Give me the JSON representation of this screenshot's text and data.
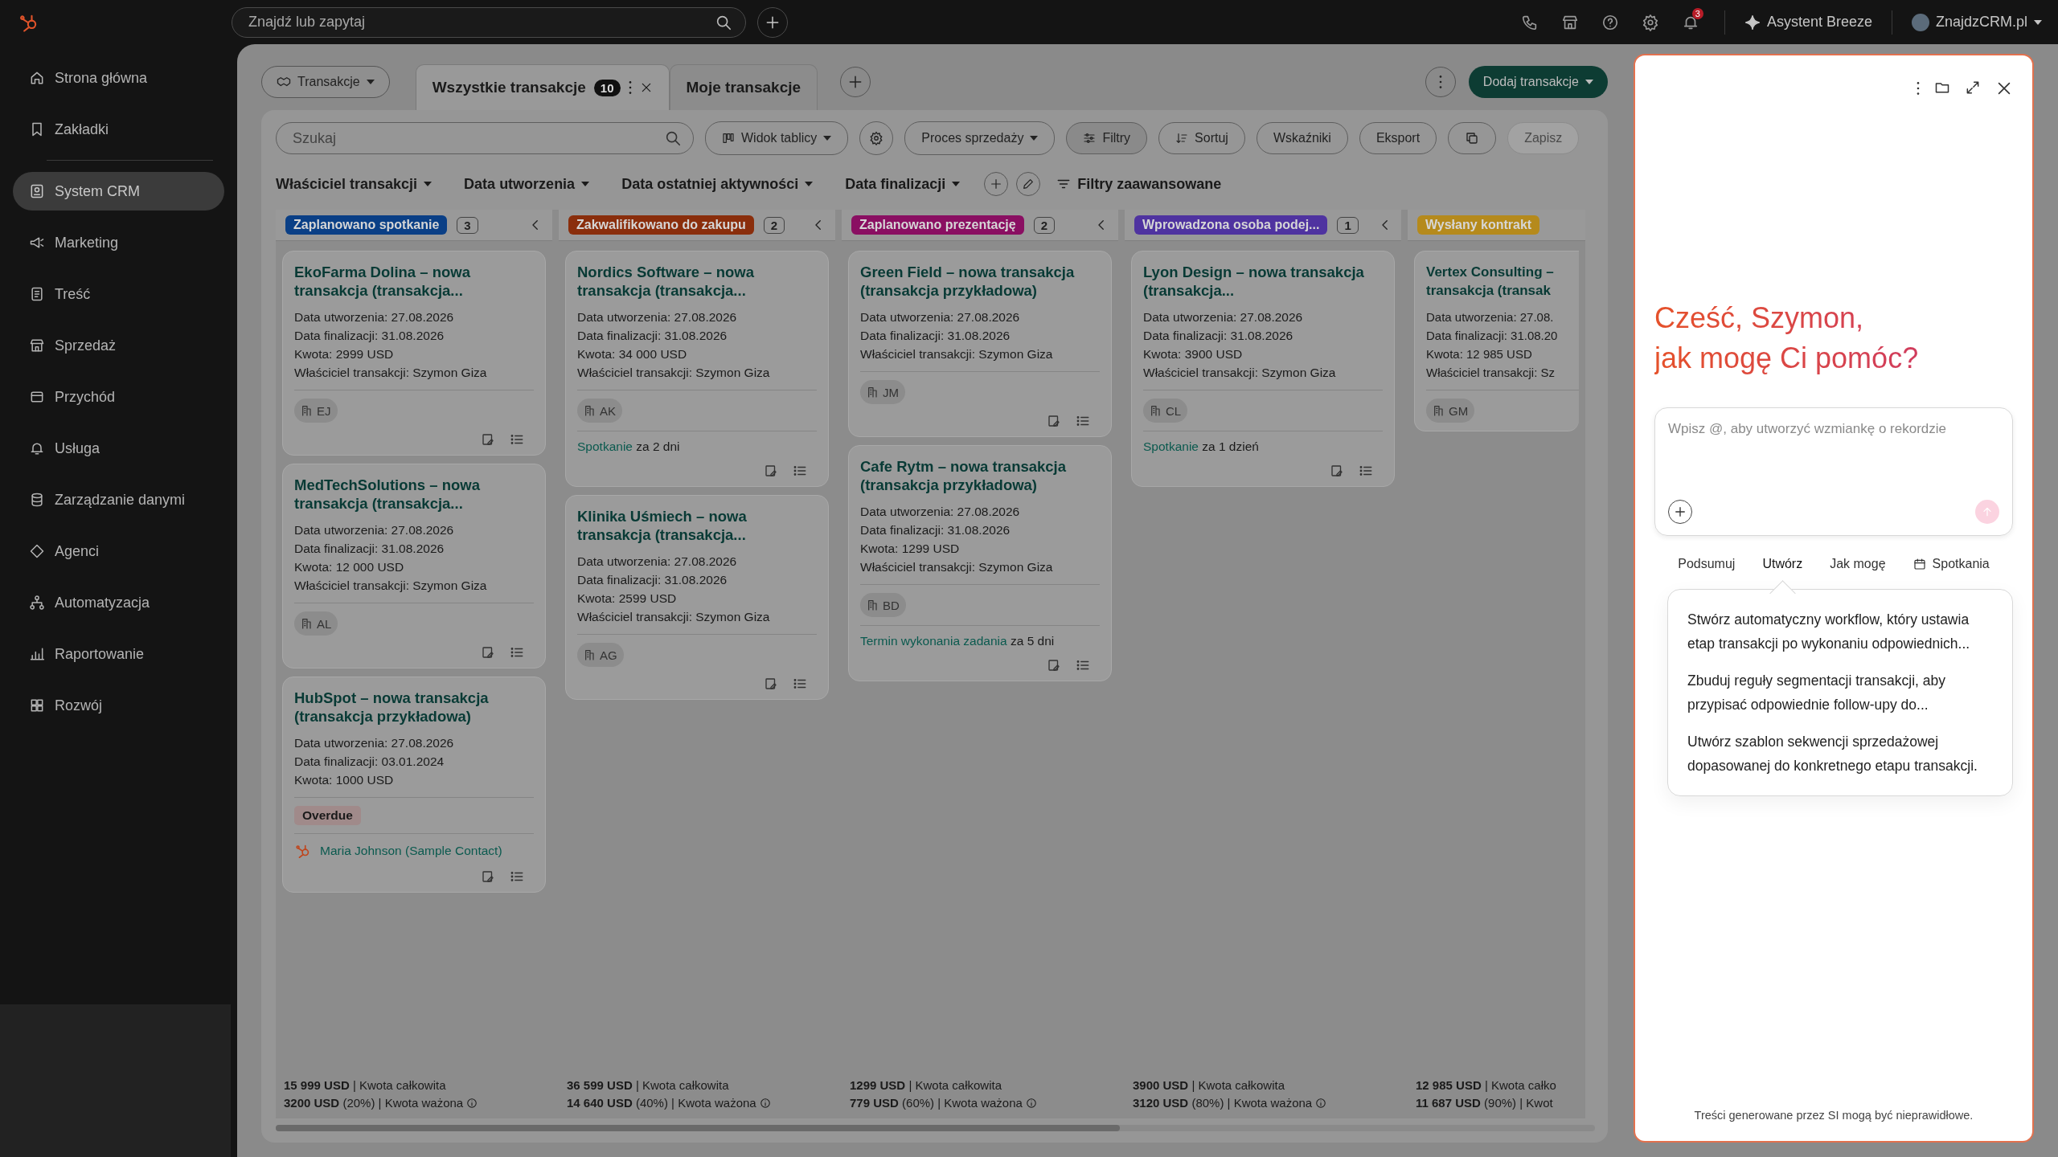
{
  "top_bar": {
    "search_placeholder": "Znajdź lub zapytaj",
    "notification_count": "3",
    "assistant": "Asystent Breeze",
    "account": "ZnajdzCRM.pl"
  },
  "sidebar": {
    "items": [
      {
        "label": "Strona główna",
        "selected": false
      },
      {
        "label": "Zakładki",
        "selected": false
      },
      {
        "label": "System CRM",
        "selected": true
      },
      {
        "label": "Marketing",
        "selected": false
      },
      {
        "label": "Treść",
        "selected": false
      },
      {
        "label": "Sprzedaż",
        "selected": false
      },
      {
        "label": "Przychód",
        "selected": false
      },
      {
        "label": "Usługa",
        "selected": false
      },
      {
        "label": "Zarządzanie danymi",
        "selected": false
      },
      {
        "label": "Agenci",
        "selected": false
      },
      {
        "label": "Automatyzacja",
        "selected": false
      },
      {
        "label": "Raportowanie",
        "selected": false
      },
      {
        "label": "Rozwój",
        "selected": false
      }
    ]
  },
  "object_selector": "Transakcje",
  "view_tabs": [
    {
      "label": "Wszystkie transakcje",
      "count": "10",
      "selected": true
    },
    {
      "label": "Moje transakcje",
      "selected": false
    }
  ],
  "add_button": "Dodaj transakcje",
  "toolbar": {
    "search_placeholder": "Szukaj",
    "view": "Widok tablicy",
    "pipeline": "Proces sprzedaży",
    "buttons": [
      {
        "label": "Filtry",
        "kind": "filter",
        "disabled": false
      },
      {
        "label": "Sortuj",
        "kind": "sort",
        "disabled": false
      },
      {
        "label": "Wskaźniki",
        "kind": "plain",
        "disabled": false
      },
      {
        "label": "Eksport",
        "kind": "plain",
        "disabled": false
      },
      {
        "kind": "copy",
        "disabled": false
      },
      {
        "label": "Zapisz",
        "kind": "plain",
        "disabled": true
      }
    ]
  },
  "filters": [
    "Właściciel transakcji",
    "Data utworzenia",
    "Data ostatniej aktywności",
    "Data finalizacji"
  ],
  "advanced_filters": "Filtry zaawansowane",
  "columns": [
    {
      "stage": "Zaplanowano spotkanie",
      "color": "#0a3f86",
      "count": "3",
      "cards": [
        {
          "title": "EkoFarma Dolina – nowa transakcja (transakcja...",
          "lines": [
            "Data utworzenia: 27.08.2026",
            "Data finalizacji: 31.08.2026",
            "Kwota: 2999 USD",
            "Właściciel transakcji: Szymon Giza"
          ],
          "initials": "EJ"
        },
        {
          "title": "MedTechSolutions – nowa transakcja (transakcja...",
          "lines": [
            "Data utworzenia: 27.08.2026",
            "Data finalizacji: 31.08.2026",
            "Kwota: 12 000 USD",
            "Właściciel transakcji: Szymon Giza"
          ],
          "initials": "AL"
        },
        {
          "title": "HubSpot – nowa transakcja (transakcja przykładowa)",
          "lines": [
            "Data utworzenia: 27.08.2026",
            "Data finalizacji: 03.01.2024",
            "Kwota: 1000 USD"
          ],
          "overdue": "Overdue",
          "contact": "Maria Johnson (Sample Contact)"
        }
      ],
      "total": "**15 999 USD** | Kwota całkowita",
      "weighted": "**3200 USD** (20%) | Kwota ważona"
    },
    {
      "stage": "Zakwalifikowano do zakupu",
      "color": "#8a2e0c",
      "count": "2",
      "cards": [
        {
          "title": "Nordics Software – nowa transakcja (transakcja...",
          "lines": [
            "Data utworzenia: 27.08.2026",
            "Data finalizacji: 31.08.2026",
            "Kwota: 34 000 USD",
            "Właściciel transakcji: Szymon Giza"
          ],
          "initials": "AK",
          "activity_link": "Spotkanie",
          "activity_text": "za 2 dni"
        },
        {
          "title": "Klinika Uśmiech – nowa transakcja (transakcja...",
          "lines": [
            "Data utworzenia: 27.08.2026",
            "Data finalizacji: 31.08.2026",
            "Kwota: 2599 USD",
            "Właściciel transakcji: Szymon Giza"
          ],
          "initials": "AG"
        }
      ],
      "total": "**36 599 USD** | Kwota całkowita",
      "weighted": "**14 640 USD** (40%) | Kwota ważona"
    },
    {
      "stage": "Zaplanowano prezentację",
      "color": "#8a0f62",
      "count": "2",
      "cards": [
        {
          "title": "Green Field – nowa transakcja (transakcja przykładowa)",
          "lines": [
            "Data utworzenia: 27.08.2026",
            "Data finalizacji: 31.08.2026",
            "Właściciel transakcji: Szymon Giza"
          ],
          "initials": "JM"
        },
        {
          "title": "Cafe Rytm – nowa transakcja (transakcja przykładowa)",
          "lines": [
            "Data utworzenia: 27.08.2026",
            "Data finalizacji: 31.08.2026",
            "Kwota: 1299 USD",
            "Właściciel transakcji: Szymon Giza"
          ],
          "initials": "BD",
          "activity_link": "Termin wykonania zadania",
          "activity_text": "za 5 dni"
        }
      ],
      "total": "**1299 USD** | Kwota całkowita",
      "weighted": "**779 USD** (60%) | Kwota ważona"
    },
    {
      "stage": "Wprowadzona osoba podej...",
      "color": "#4f33a0",
      "count": "1",
      "cards": [
        {
          "title": "Lyon Design – nowa transakcja (transakcja...",
          "lines": [
            "Data utworzenia: 27.08.2026",
            "Data finalizacji: 31.08.2026",
            "Kwota: 3900 USD",
            "Właściciel transakcji: Szymon Giza"
          ],
          "initials": "CL",
          "activity_link": "Spotkanie",
          "activity_text": "za 1 dzień"
        }
      ],
      "total": "**3900 USD** | Kwota całkowita",
      "weighted": "**3120 USD** (80%) | Kwota ważona"
    },
    {
      "stage": "Wysłany kontrakt",
      "color": "#b58a1c",
      "cards": [
        {
          "title": "Vertex Consulting – transakcja (transak",
          "lines": [
            "Data utworzenia: 27.08.",
            "Data finalizacji: 31.08.20",
            "Kwota: 12 985 USD",
            "Właściciel transakcji: Sz"
          ],
          "initials": "GM"
        }
      ],
      "total": "**12 985 USD** | Kwota całko",
      "weighted": "**11 687 USD** (90%) | Kwot"
    }
  ],
  "chat": {
    "greeting": [
      "Cześć, Szymon,",
      "jak mogę Ci pomóc?"
    ],
    "placeholder": "Wpisz @, aby utworzyć wzmiankę o rekordzie",
    "quick_actions": [
      {
        "label": "Podsumuj",
        "selected": false
      },
      {
        "label": "Utwórz",
        "selected": true
      },
      {
        "label": "Jak mogę",
        "selected": false
      },
      {
        "label": "Spotkania",
        "selected": false,
        "kind": "calendar"
      }
    ],
    "suggestions": [
      "Stwórz automatyczny workflow, który ustawia etap transakcji po wykonaniu odpowiednich...",
      "Zbuduj reguły segmentacji transakcji, aby przypisać odpowiednie follow-upy do...",
      "Utwórz szablon sekwencji sprzedażowej dopasowanej do konkretnego etapu transakcji."
    ],
    "disclaimer": "Treści generowane przez SI mogą być nieprawidłowe."
  }
}
